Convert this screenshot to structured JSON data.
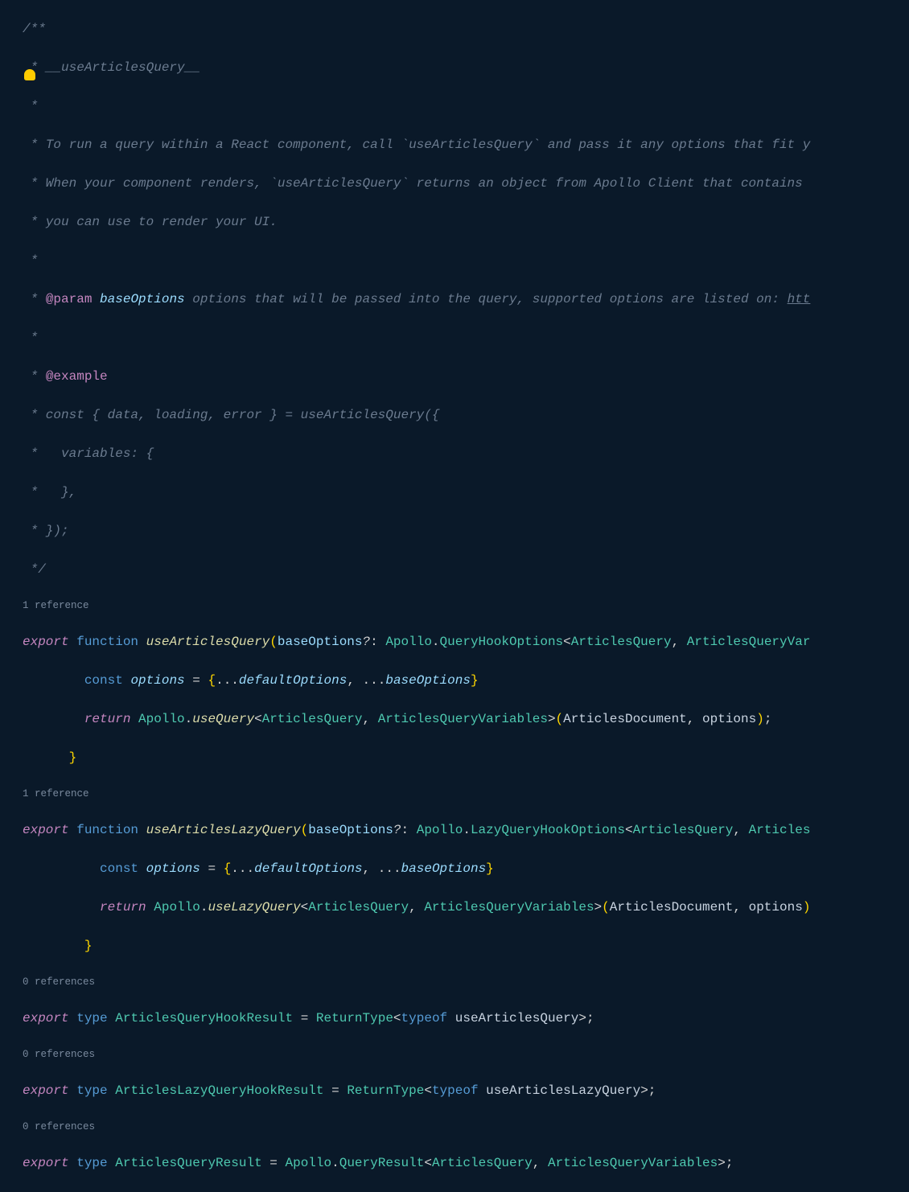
{
  "doc": {
    "open": "/**",
    "l1": " * __useArticlesQuery__",
    "l2": " *",
    "l3": " * To run a query within a React component, call `useArticlesQuery` and pass it any options that fit y",
    "l4": " * When your component renders, `useArticlesQuery` returns an object from Apollo Client that contains ",
    "l5": " * you can use to render your UI.",
    "l6": " *",
    "l7a": " * ",
    "param_tag": "@param",
    "param_name": "baseOptions",
    "l7b": " options that will be passed into the query, supported options are listed on: ",
    "l7c": "htt",
    "l8": " *",
    "l9a": " * ",
    "example_tag": "@example",
    "l10": " * const { data, loading, error } = useArticlesQuery({",
    "l11": " *   variables: {",
    "l12": " *   },",
    "l13": " * });",
    "close": " */"
  },
  "codelens": {
    "one_ref": "1 reference",
    "zero_ref": "0 references"
  },
  "kw": {
    "export": "export",
    "function": "function",
    "const": "const",
    "return": "return",
    "type": "type",
    "typeof": "typeof"
  },
  "fn1": {
    "name": "useArticlesQuery",
    "param": "baseOptions",
    "apollo": "Apollo",
    "hook_opts": "QueryHookOptions",
    "q": "ArticlesQuery",
    "qv": "ArticlesQueryVar",
    "options": "options",
    "default_opts": "defaultOptions",
    "base_opts": "baseOptions",
    "use_query": "useQuery",
    "qv_full": "ArticlesQueryVariables",
    "doc": "ArticlesDocument"
  },
  "fn2": {
    "name": "useArticlesLazyQuery",
    "param": "baseOptions",
    "apollo": "Apollo",
    "hook_opts": "LazyQueryHookOptions",
    "q": "ArticlesQuery",
    "qv": "Articles",
    "options": "options",
    "default_opts": "defaultOptions",
    "base_opts": "baseOptions",
    "use_lazy": "useLazyQuery",
    "qv_full": "ArticlesQueryVariables",
    "doc": "ArticlesDocument"
  },
  "t1": {
    "name": "ArticlesQueryHookResult",
    "rt": "ReturnType",
    "of": "useArticlesQuery"
  },
  "t2": {
    "name": "ArticlesLazyQueryHookResult",
    "rt": "ReturnType",
    "of": "useArticlesLazyQuery"
  },
  "t3": {
    "name": "ArticlesQueryResult",
    "apollo": "Apollo",
    "qr": "QueryResult",
    "q": "ArticlesQuery",
    "qv": "ArticlesQueryVariables"
  }
}
